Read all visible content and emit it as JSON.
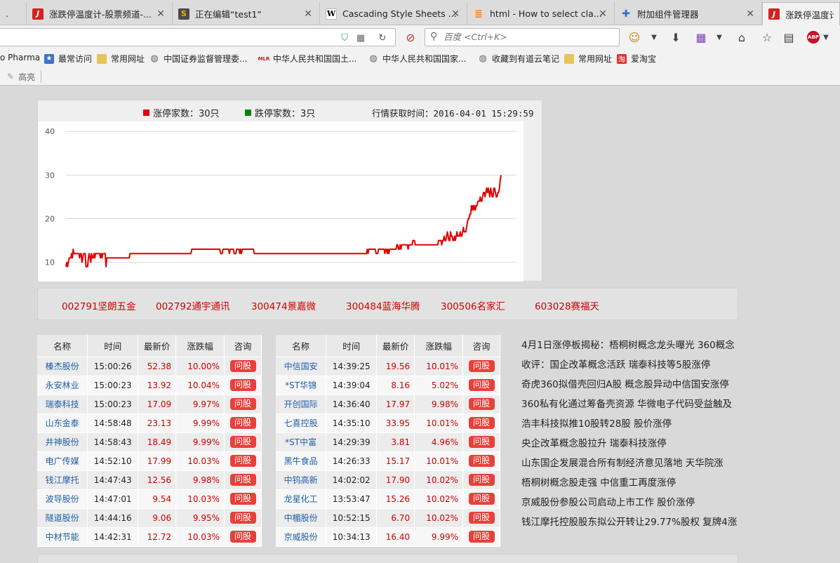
{
  "tabs": [
    {
      "title": ".",
      "favicon": "page-icon",
      "active": false
    },
    {
      "title": "涨跌停温度计-股票频道-...",
      "favicon": "jrj-logo-icon",
      "active": false
    },
    {
      "title": "正在编辑“test1”",
      "favicon": "sublime-icon",
      "active": false
    },
    {
      "title": "Cascading Style Sheets ...",
      "favicon": "wikipedia-icon",
      "active": false
    },
    {
      "title": "html - How to select cla...",
      "favicon": "stackoverflow-icon",
      "active": false
    },
    {
      "title": "附加组件管理器",
      "favicon": "puzzle-icon",
      "active": false
    },
    {
      "title": "涨跌停温度计-B",
      "favicon": "jrj-logo-icon",
      "active": true
    }
  ],
  "navbar": {
    "search_placeholder": "百度 <Ctrl+K>"
  },
  "bookmarks": [
    {
      "label": "o Pharma",
      "icon": "none"
    },
    {
      "label": "最常访问",
      "icon": "bookmark-folder-icon"
    },
    {
      "label": "常用网址",
      "icon": "folder-icon"
    },
    {
      "label": "中国证券监督管理委...",
      "icon": "globe-icon"
    },
    {
      "label": "中华人民共和国国土...",
      "icon": "mlr-logo-icon"
    },
    {
      "label": "中华人民共和国国家...",
      "icon": "globe-icon"
    },
    {
      "label": "收藏到有道云笔记",
      "icon": "globe-icon"
    },
    {
      "label": "常用网址",
      "icon": "folder-icon"
    },
    {
      "label": "爱淘宝",
      "icon": "taobao-icon"
    }
  ],
  "addon_bar": {
    "highlight_label": "高亮"
  },
  "chart_header": {
    "up_label": "涨停家数：30只",
    "down_label": "跌停家数：3只",
    "time_label": "行情获取时间：2016-04-01 15:29:59",
    "up_color": "#e00000",
    "down_color": "#008800"
  },
  "chart_data": {
    "type": "line",
    "title": "",
    "xlabel": "",
    "ylabel": "",
    "y_ticks": [
      "40",
      "30",
      "20",
      "10"
    ],
    "ylim": [
      6,
      41
    ],
    "grid": true,
    "series": [
      {
        "name": "涨停家数",
        "color": "#e00000",
        "values": [
          9,
          10,
          9,
          10,
          11,
          11,
          11,
          12,
          11,
          13,
          12,
          12,
          12,
          12,
          12,
          12,
          12,
          11,
          12,
          12,
          10,
          11,
          12,
          12,
          12,
          9,
          9,
          9,
          11,
          12,
          11,
          10,
          12,
          11,
          11,
          12,
          11,
          12,
          12,
          12,
          12,
          12,
          12,
          11,
          12,
          11,
          12,
          12,
          12,
          12,
          9,
          11,
          11,
          11,
          11,
          11,
          11,
          11,
          11,
          11,
          11,
          11,
          11,
          11,
          11,
          11,
          11,
          11,
          11,
          11,
          11,
          11,
          11,
          11,
          11,
          11,
          11,
          11,
          11,
          11,
          12,
          12,
          12,
          12,
          12,
          12,
          12,
          12,
          12,
          12,
          12,
          12,
          12,
          12,
          12,
          12,
          12,
          12,
          12,
          12,
          12,
          12,
          12,
          12,
          12,
          12,
          12,
          12,
          12,
          12,
          12,
          12,
          12,
          12,
          12,
          12,
          12,
          12,
          12,
          12,
          12,
          12,
          12,
          12,
          12,
          12,
          12,
          12,
          12,
          12,
          12,
          12,
          12,
          12,
          12,
          12,
          12,
          12,
          12,
          12,
          12,
          12,
          12,
          12,
          12,
          12,
          12,
          12,
          12,
          12,
          12,
          12,
          12,
          12,
          12,
          12,
          12,
          13,
          13,
          13,
          13,
          13,
          13,
          13,
          13,
          13,
          13,
          13,
          13,
          13,
          13,
          13,
          13,
          13,
          13,
          13,
          13,
          13,
          13,
          13,
          13,
          13,
          13,
          13,
          13,
          13,
          13,
          13,
          13,
          13,
          13,
          13,
          13,
          12,
          12,
          12,
          13,
          13,
          13,
          13,
          13,
          13,
          13,
          13,
          12,
          13,
          13,
          13,
          13,
          13,
          12,
          12,
          12,
          13,
          13,
          13,
          13,
          12,
          13,
          12,
          13,
          13,
          13,
          13,
          13,
          13,
          13,
          13,
          13,
          13,
          13,
          13,
          13,
          13,
          13,
          12,
          12,
          12,
          12,
          12,
          12,
          12,
          12,
          12,
          12,
          12,
          12,
          12,
          12,
          12,
          12,
          12,
          12,
          12,
          12,
          12,
          12,
          12,
          12,
          12,
          12,
          12,
          12,
          12,
          12,
          12,
          12,
          12,
          12,
          12,
          12,
          12,
          12,
          12,
          12,
          12,
          12,
          12,
          12,
          12,
          12,
          12,
          12,
          12,
          12,
          12,
          12,
          12,
          12,
          12,
          12,
          12,
          12,
          12,
          12,
          12,
          12,
          12,
          12,
          12,
          12,
          12,
          12,
          12,
          12,
          12,
          12,
          12,
          12,
          12,
          12,
          12,
          12,
          12,
          12,
          12,
          12,
          12,
          12,
          12,
          12,
          12,
          12,
          12,
          12,
          12,
          12,
          12,
          12,
          12,
          12,
          12,
          12,
          12,
          12,
          12,
          12,
          12,
          12,
          12,
          12,
          12,
          12,
          12,
          12,
          12,
          12,
          12,
          12,
          12,
          12,
          12,
          12,
          12,
          12,
          12,
          12,
          12,
          12,
          12,
          12,
          12,
          12,
          12,
          12,
          12,
          12,
          12,
          12,
          12,
          12,
          12,
          12,
          12,
          12,
          12,
          13,
          12,
          13,
          13,
          13,
          13,
          13,
          13,
          13,
          13,
          13,
          12,
          12,
          12,
          13,
          13,
          13,
          13,
          13,
          13,
          13,
          13,
          12,
          13,
          13,
          12,
          13,
          12,
          13,
          13,
          13,
          13,
          13,
          13,
          13,
          13,
          13,
          14,
          14,
          13,
          13,
          14,
          13,
          14,
          14,
          14,
          14,
          14,
          14,
          14,
          14,
          13,
          14,
          14,
          14,
          14,
          14,
          15,
          15,
          15,
          14,
          14,
          14,
          14,
          14,
          14,
          14,
          14,
          14,
          14,
          14,
          14,
          14,
          14,
          14,
          14,
          14,
          14,
          14,
          14,
          14,
          14,
          14,
          14,
          14,
          14,
          14,
          14,
          14,
          15,
          15,
          15,
          15,
          14,
          15,
          15,
          16,
          15,
          15,
          16,
          17,
          16,
          15,
          15,
          17,
          16,
          16,
          15,
          15,
          16,
          15,
          16,
          17,
          16,
          16,
          16,
          17,
          16,
          16,
          17,
          18,
          17,
          17,
          17,
          18,
          19,
          20,
          20,
          21,
          21,
          23,
          22,
          23,
          22,
          23,
          22,
          23,
          23,
          24,
          24,
          24,
          25,
          24,
          24,
          25,
          26,
          26,
          25,
          26,
          27,
          26,
          27,
          26,
          25,
          27,
          26,
          25,
          25,
          27,
          27,
          26,
          25,
          25,
          26,
          26,
          27,
          29,
          30
        ]
      }
    ],
    "down_series_note_visible": false
  },
  "stock_strip": [
    {
      "label": "002791坚朗五金"
    },
    {
      "label": "002792通宇通讯"
    },
    {
      "label": "300474景嘉微"
    },
    {
      "label": "300484蓝海华腾"
    },
    {
      "label": "300506名家汇"
    },
    {
      "label": "603028赛福天"
    }
  ],
  "table_headers": [
    "名称",
    "时间",
    "最新价",
    "涨跌幅",
    "咨询"
  ],
  "ask_label": "问股",
  "left_table": [
    {
      "name": "榛杰股份",
      "time": "15:00:26",
      "price": "52.38",
      "pct": "10.00%"
    },
    {
      "name": "永安林业",
      "time": "15:00:23",
      "price": "13.92",
      "pct": "10.04%"
    },
    {
      "name": "瑞泰科技",
      "time": "15:00:23",
      "price": "17.09",
      "pct": "9.97%"
    },
    {
      "name": "山东金泰",
      "time": "14:58:48",
      "price": "23.13",
      "pct": "9.99%"
    },
    {
      "name": "井神股份",
      "time": "14:58:43",
      "price": "18.49",
      "pct": "9.99%"
    },
    {
      "name": "电广传媒",
      "time": "14:52:10",
      "price": "17.99",
      "pct": "10.03%"
    },
    {
      "name": "钱江摩托",
      "time": "14:47:43",
      "price": "12.56",
      "pct": "9.98%"
    },
    {
      "name": "波导股份",
      "time": "14:47:01",
      "price": "9.54",
      "pct": "10.03%"
    },
    {
      "name": "隧道股份",
      "time": "14:44:16",
      "price": "9.06",
      "pct": "9.95%"
    },
    {
      "name": "中材节能",
      "time": "14:42:31",
      "price": "12.72",
      "pct": "10.03%"
    }
  ],
  "right_table": [
    {
      "name": "中信国安",
      "time": "14:39:25",
      "price": "19.56",
      "pct": "10.01%"
    },
    {
      "name": "*ST华锦",
      "time": "14:39:04",
      "price": "8.16",
      "pct": "5.02%"
    },
    {
      "name": "开创国际",
      "time": "14:36:40",
      "price": "17.97",
      "pct": "9.98%"
    },
    {
      "name": "七喜控股",
      "time": "14:35:10",
      "price": "33.95",
      "pct": "10.01%"
    },
    {
      "name": "*ST中富",
      "time": "14:29:39",
      "price": "3.81",
      "pct": "4.96%"
    },
    {
      "name": "黑牛食品",
      "time": "14:26:33",
      "price": "15.17",
      "pct": "10.01%"
    },
    {
      "name": "中钨高新",
      "time": "14:02:02",
      "price": "17.90",
      "pct": "10.02%"
    },
    {
      "name": "龙星化工",
      "time": "13:53:47",
      "price": "15.26",
      "pct": "10.02%"
    },
    {
      "name": "中楣股份",
      "time": "10:52:15",
      "price": "6.70",
      "pct": "10.02%"
    },
    {
      "name": "京威股份",
      "time": "10:34:13",
      "price": "16.40",
      "pct": "9.99%"
    }
  ],
  "news": [
    "4月1日涨停板揭秘：梧桐树概念龙头曝光 360概念",
    "收评：国企改革概念活跃 瑞泰科技等5股涨停",
    "奇虎360拟借壳回归A股 概念股异动中信国安涨停",
    "360私有化通过筹备壳资源 华微电子代码受益触及",
    "浩丰科技拟推10股转28股 股价涨停",
    "央企改革概念股拉升 瑞泰科技涨停",
    "山东国企发展混合所有制经济意见落地 天华院涨",
    "梧桐树概念股走强 中信重工再度涨停",
    "京威股份参股公司启动上市工作 股价涨停",
    "钱江摩托控股股东拟公开转让29.77%股权 复牌4涨"
  ]
}
